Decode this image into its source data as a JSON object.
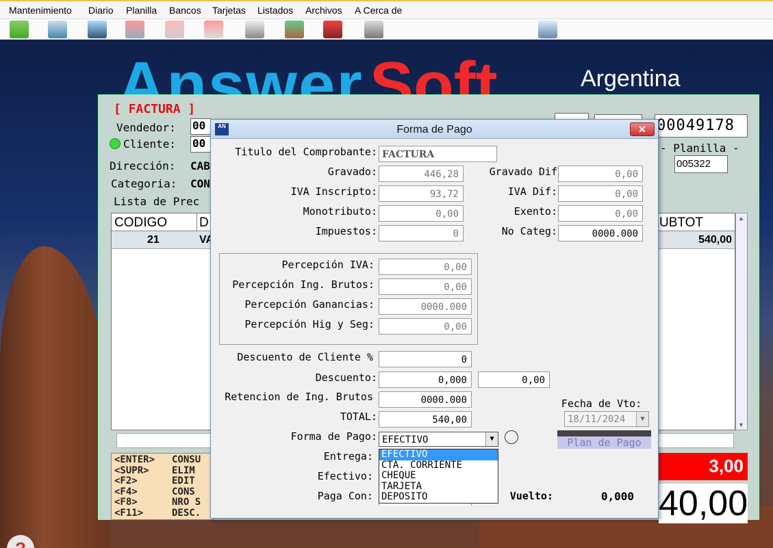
{
  "menu": [
    "Mantenimiento",
    "Diario",
    "Planilla",
    "Bancos",
    "Tarjetas",
    "Listados",
    "Archivos",
    "A Cerca de"
  ],
  "toolbar_icons": [
    "users-icon",
    "search-icon",
    "person-icon",
    "report-icon",
    "print-icon",
    "print2-icon",
    "cart-icon",
    "stock-icon",
    "forklift-icon",
    "boxes-icon",
    "tag-icon"
  ],
  "brand": {
    "part1": "Answer",
    "part2": "Soft",
    "country": "Argentina"
  },
  "factura": {
    "title": "[ FACTURA ]",
    "vendedor_label": "Vendedor:",
    "vendedor_value": "00",
    "cliente_label": "Cliente:",
    "cliente_value": "00",
    "direccion_label": "Dirección:",
    "direccion_value": "CAB",
    "categoria_label": "Categoria:",
    "categoria_value": "CON",
    "lista_label": "Lista de Prec",
    "numero": "00049178",
    "planilla_label": "- Planilla -",
    "planilla_value": "005322",
    "grid": {
      "col_codigo": "CODIGO",
      "col_d": "D",
      "col_subtot": "UBTOT",
      "row": {
        "codigo": "21",
        "desc": "VA",
        "subtot": "540,00"
      }
    },
    "keys": [
      {
        "key": "<ENTER>",
        "desc": "CONSU"
      },
      {
        "key": "<SUPR>",
        "desc": "ELIM"
      },
      {
        "key": "<F2>",
        "desc": "EDIT"
      },
      {
        "key": "<F4>",
        "desc": "CONS"
      },
      {
        "key": "<F8>",
        "desc": "NRO S"
      },
      {
        "key": "<F11>",
        "desc": "DESC."
      }
    ],
    "red_value": "3,00",
    "big_total": "40,00"
  },
  "dialog": {
    "title": "Forma de Pago",
    "logo": "AN",
    "close": "✕",
    "titulo_label": "Titulo del Comprobante:",
    "titulo_value": "FACTURA",
    "gravado_label": "Gravado:",
    "gravado_value": "446,28",
    "gravado_dif_label": "Gravado Dif",
    "gravado_dif_value": "0,00",
    "iva_ins_label": "IVA Inscripto:",
    "iva_ins_value": "93,72",
    "iva_dif_label": "IVA Dif:",
    "iva_dif_value": "0,00",
    "mono_label": "Monotributo:",
    "mono_value": "0,00",
    "exento_label": "Exento:",
    "exento_value": "0,00",
    "impuestos_label": "Impuestos:",
    "impuestos_value": "0",
    "nocateg_label": "No Categ:",
    "nocateg_value": "0000.000",
    "perc_iva_label": "Percepción IVA:",
    "perc_iva_value": "0,00",
    "perc_ib_label": "Percepción Ing. Brutos:",
    "perc_ib_value": "0,00",
    "perc_gan_label": "Percepción Ganancias:",
    "perc_gan_value": "0000.000",
    "perc_hig_label": "Percepción Hig y Seg:",
    "perc_hig_value": "0,00",
    "desc_cli_label": "Descuento de Cliente %",
    "desc_cli_value": "0",
    "descuento_label": "Descuento:",
    "descuento_value": "0,000",
    "descuento_value2": "0,00",
    "ret_label": "Retencion de Ing. Brutos",
    "ret_value": "0000.000",
    "total_label": "TOTAL:",
    "total_value": "540,00",
    "fecha_label": "Fecha de Vto:",
    "fecha_value": "18/11/2024",
    "forma_label": "Forma de Pago:",
    "forma_value": "EFECTIVO",
    "forma_options": [
      "EFECTIVO",
      "CTA. CORRIENTE",
      "CHEQUE",
      "TARJETA",
      "DEPOSITO"
    ],
    "plan_label": "Plan de Pago",
    "entrega_label": "Entrega:",
    "efectivo_label": "Efectivo:",
    "paga_label": "Paga Con:",
    "vuelto_label": "Vuelto:",
    "vuelto_value": "0,000"
  }
}
